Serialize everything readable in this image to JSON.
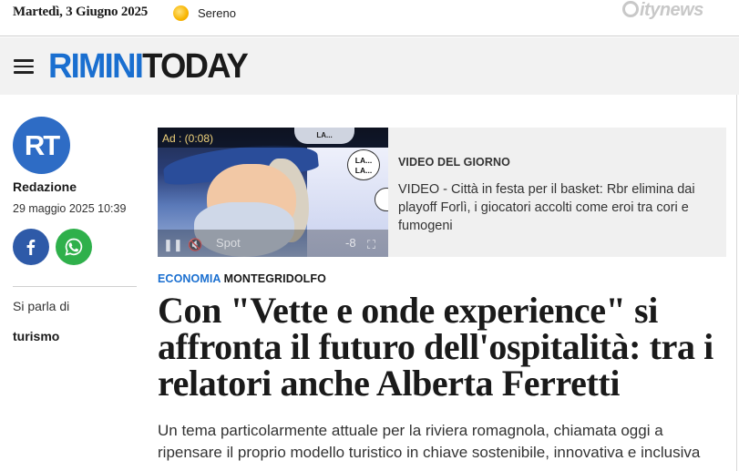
{
  "topbar": {
    "date": "Martedì, 3 Giugno 2025",
    "weather_icon": "sun-icon",
    "weather_label": "Sereno",
    "network_brand": "citynews"
  },
  "header": {
    "menu_icon": "hamburger-menu-icon",
    "logo_part1": "RIMINI",
    "logo_part2": "TODAY",
    "logo_color_primary": "#1a6fd0"
  },
  "author": {
    "avatar_initials": "RT",
    "name": "Redazione",
    "published": "29 maggio 2025 10:39"
  },
  "share": {
    "facebook_icon": "facebook-icon",
    "whatsapp_icon": "whatsapp-icon"
  },
  "topics": {
    "label": "Si parla di",
    "items": [
      "turismo"
    ]
  },
  "video": {
    "ad_label": "Ad : (0:08)",
    "bubble_top": "LA...",
    "bubble_side": "LA... LA...",
    "spot_label": "Spot",
    "counter": "-8",
    "section_label": "VIDEO DEL GIORNO",
    "title": "VIDEO - Città in festa per il basket: Rbr elimina dai playoff Forlì, i giocatori accolti come eroi tra cori e fumogeni"
  },
  "article": {
    "category": "ECONOMIA",
    "location": "MONTEGRIDOLFO",
    "headline": "Con \"Vette e onde experience\" si affronta il futuro dell'ospitalità: tra i relatori anche Alberta Ferretti",
    "subheadline": "Un tema particolarmente attuale per la riviera romagnola, chiamata oggi a ripensare il proprio modello turistico in chiave sostenibile, innovativa e inclusiva"
  }
}
